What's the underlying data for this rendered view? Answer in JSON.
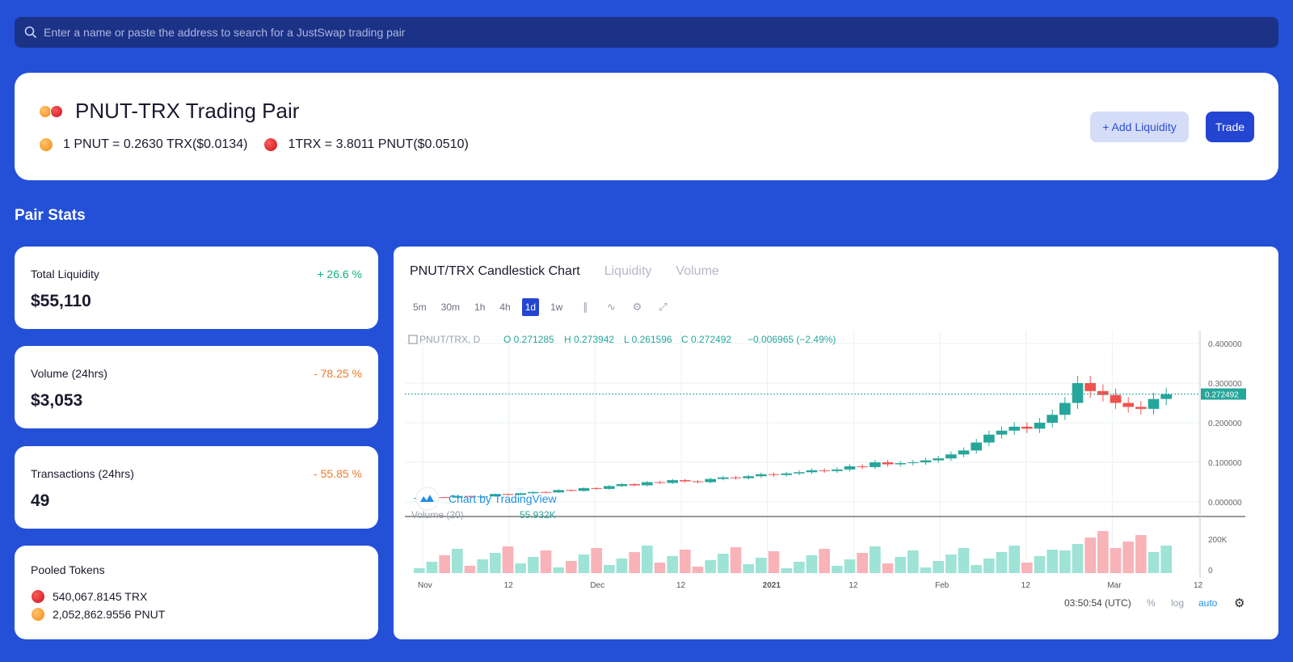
{
  "search": {
    "placeholder": "Enter a name or paste the address to search for a JustSwap trading pair"
  },
  "pair": {
    "title": "PNUT-TRX Trading Pair",
    "rate1": "1 PNUT = 0.2630 TRX($0.0134)",
    "rate2": "1TRX = 3.8011 PNUT($0.0510)",
    "add_liquidity_label": "+ Add Liquidity",
    "trade_label": "Trade"
  },
  "section_title": "Pair Stats",
  "stats": [
    {
      "label": "Total Liquidity",
      "value": "$55,110",
      "change": "+ 26.6 %"
    },
    {
      "label": "Volume (24hrs)",
      "value": "$3,053",
      "change": "- 78.25 %"
    },
    {
      "label": "Transactions (24hrs)",
      "value": "49",
      "change": "- 55.85 %"
    }
  ],
  "pooled": {
    "label": "Pooled Tokens",
    "trx": "540,067.8145 TRX",
    "pnut": "2,052,862.9556 PNUT"
  },
  "chart_tabs": [
    "PNUT/TRX Candlestick Chart",
    "Liquidity",
    "Volume"
  ],
  "timeframes": [
    "5m",
    "30m",
    "1h",
    "4h",
    "1d",
    "1w"
  ],
  "active_timeframe": "1d",
  "legend": {
    "symbol": "PNUT/TRX, D",
    "o": "0.271285",
    "h": "0.273942",
    "l": "0.261596",
    "c": "0.272492",
    "change": "−0.006965 (−2.49%)",
    "volume_label": "Volume (20)",
    "volume_value": "55.932K",
    "watermark": "Chart by TradingView",
    "last_price": "0.272492"
  },
  "footer": {
    "time": "03:50:54 (UTC)",
    "pct": "%",
    "log": "log",
    "auto": "auto"
  },
  "colors": {
    "up": "#26a69a",
    "down": "#ef5350",
    "accent": "#2345d2"
  },
  "chart_data": {
    "type": "candlestick",
    "price_axis_ticks": [
      "0.400000",
      "0.300000",
      "0.200000",
      "0.100000",
      "0.000000"
    ],
    "volume_axis_ticks": [
      "200K",
      "0"
    ],
    "time_axis_ticks": [
      "Nov",
      "12",
      "Dec",
      "12",
      "2021",
      "12",
      "Feb",
      "12",
      "Mar",
      "12"
    ],
    "ylim": [
      0,
      0.4
    ],
    "closes": [
      0.01,
      0.012,
      0.011,
      0.015,
      0.013,
      0.014,
      0.02,
      0.018,
      0.022,
      0.025,
      0.024,
      0.03,
      0.028,
      0.035,
      0.033,
      0.04,
      0.045,
      0.042,
      0.05,
      0.048,
      0.055,
      0.052,
      0.05,
      0.058,
      0.062,
      0.06,
      0.065,
      0.07,
      0.068,
      0.072,
      0.075,
      0.08,
      0.078,
      0.082,
      0.09,
      0.088,
      0.1,
      0.095,
      0.098,
      0.1,
      0.105,
      0.11,
      0.12,
      0.13,
      0.15,
      0.17,
      0.18,
      0.19,
      0.185,
      0.2,
      0.22,
      0.25,
      0.3,
      0.28,
      0.27,
      0.25,
      0.24,
      0.235,
      0.26,
      0.272
    ]
  }
}
